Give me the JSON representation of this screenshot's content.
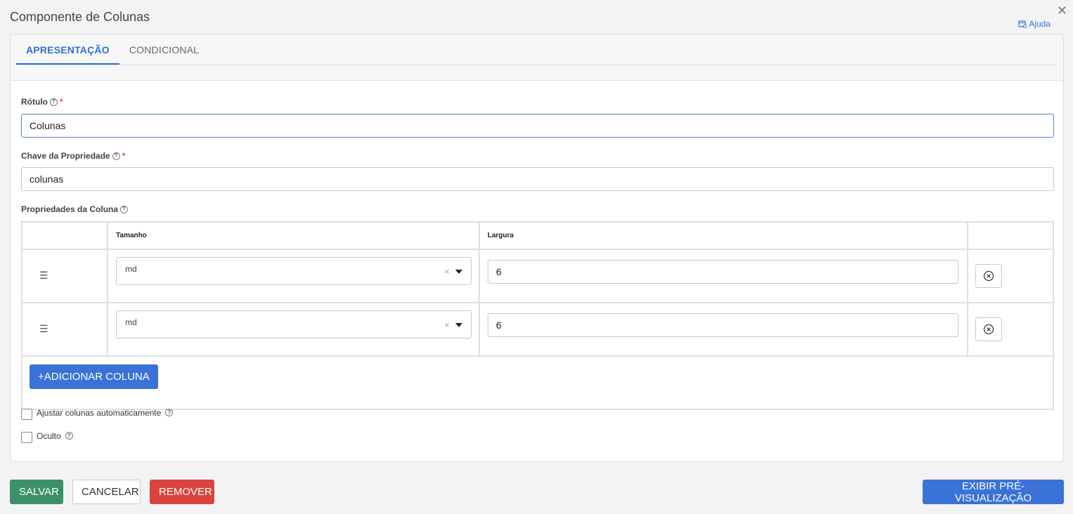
{
  "dialog": {
    "title": "Componente de Colunas",
    "help_label": "Ajuda"
  },
  "tabs": [
    {
      "label": "APRESENTAÇÃO",
      "active": true
    },
    {
      "label": "CONDICIONAL",
      "active": false
    }
  ],
  "fields": {
    "label": {
      "label": "Rótulo",
      "required_mark": "*",
      "value": "Colunas"
    },
    "property_key": {
      "label": "Chave da Propriedade",
      "required_mark": "*",
      "value": "colunas"
    },
    "column_properties": {
      "label": "Propriedades da Coluna"
    }
  },
  "columns_table": {
    "headers": [
      "",
      "Tamanho",
      "Largura",
      ""
    ],
    "drag_glyph": "☰",
    "rows": [
      {
        "size": "md",
        "width": "6"
      },
      {
        "size": "md",
        "width": "6"
      }
    ],
    "add_button": "ADICIONAR COLUNA",
    "add_glyph": "+"
  },
  "checkboxes": [
    {
      "label": "Ajustar colunas automaticamente",
      "checked": false
    },
    {
      "label": "Oculto",
      "checked": false
    }
  ],
  "footer": {
    "save": "SALVAR",
    "cancel": "CANCELAR",
    "remove": "REMOVER",
    "preview": "EXIBIR PRÉ-VISUALIZAÇÃO"
  },
  "colors": {
    "accent": "#3a72d8",
    "save": "#3b9068",
    "danger": "#d9443f"
  },
  "icons": {
    "close": "close-icon",
    "help": "help-book-icon",
    "question": "question-circle-icon",
    "drag": "drag-handle-icon",
    "remove": "x-circle-icon"
  }
}
